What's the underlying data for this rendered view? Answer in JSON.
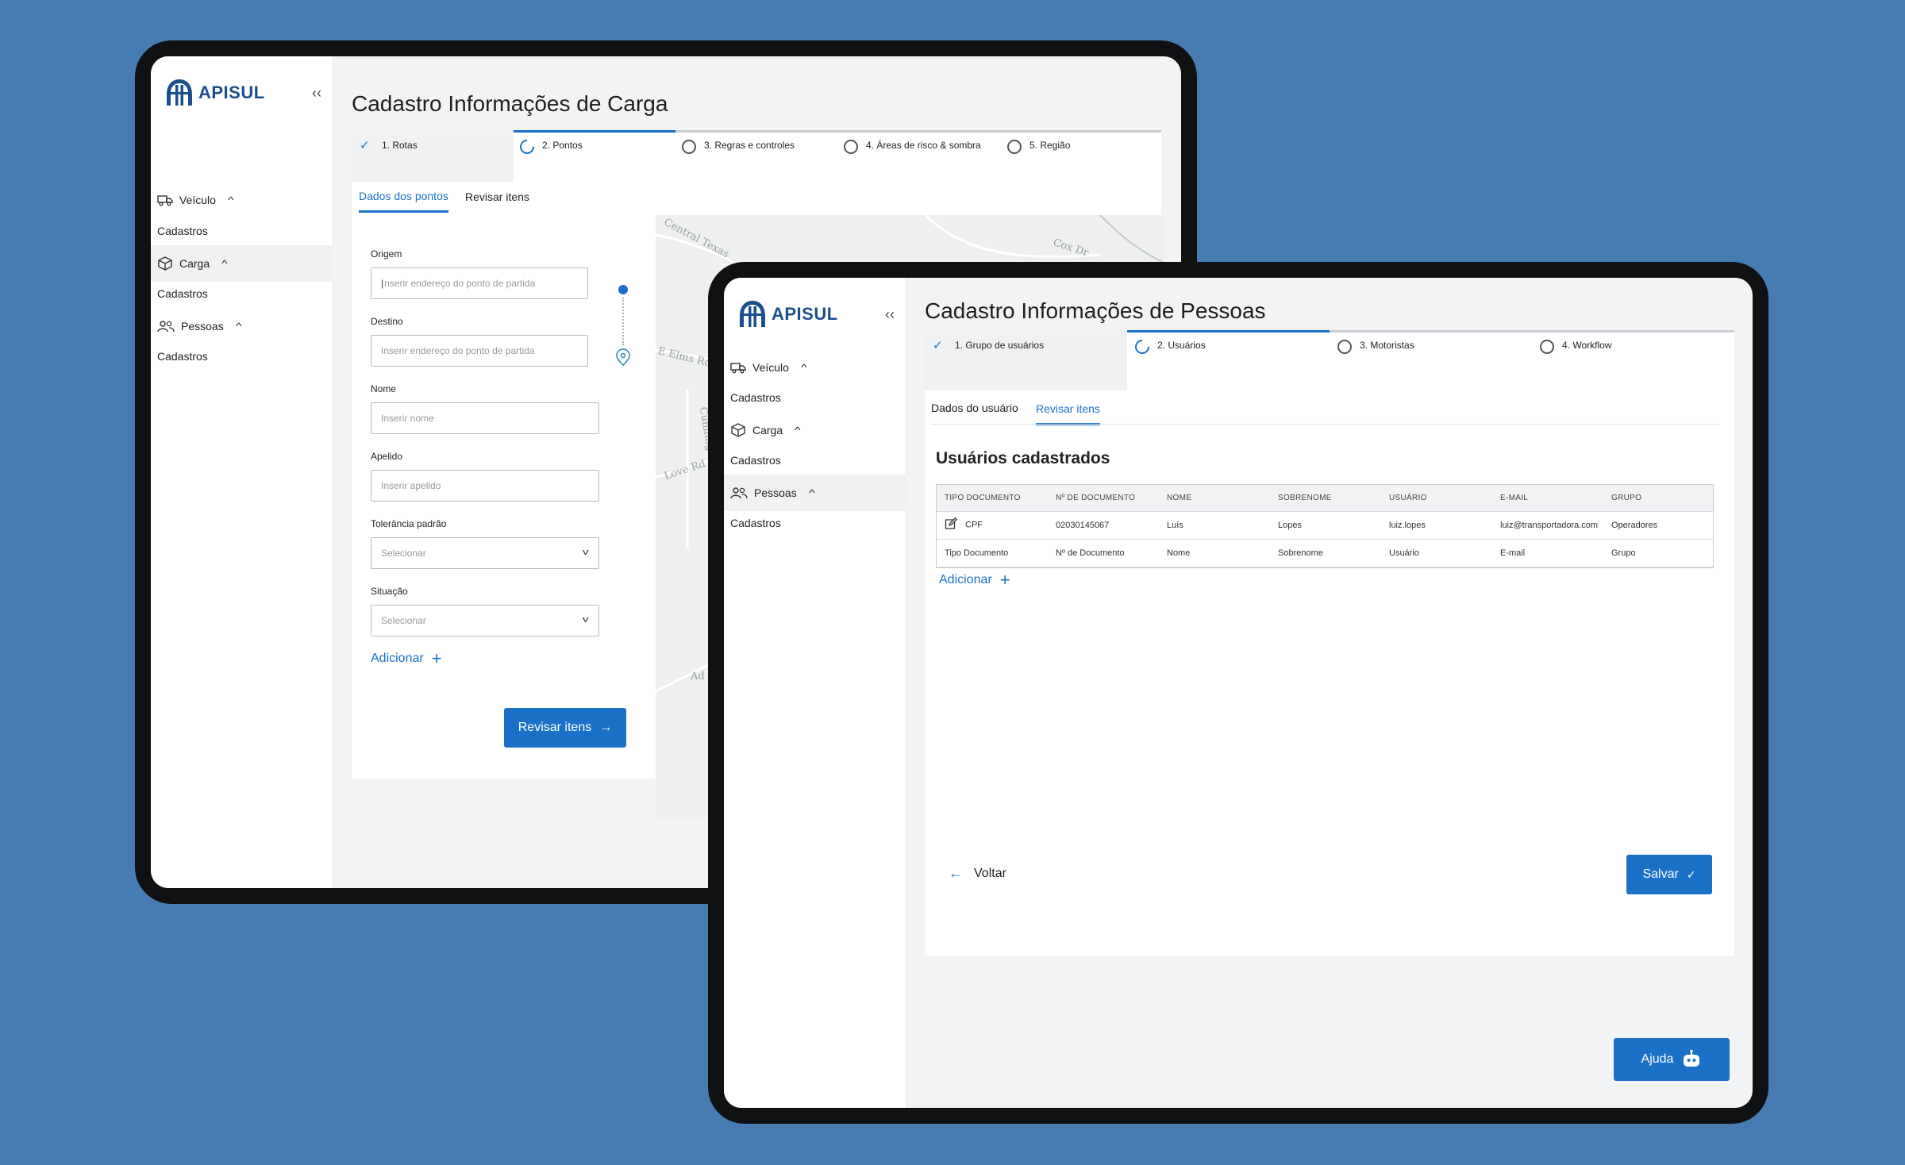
{
  "back_window": {
    "logo": "APISUL",
    "title": "Cadastro Informações de Carga",
    "sidebar": [
      {
        "label": "Veículo",
        "sub": "Cadastros"
      },
      {
        "label": "Carga",
        "sub": "Cadastros"
      },
      {
        "label": "Pessoas",
        "sub": "Cadastros"
      }
    ],
    "steps": [
      "1. Rotas",
      "2. Pontos",
      "3. Regras e controles",
      "4. Áreas de risco & sombra",
      "5. Região"
    ],
    "tabs": [
      "Dados dos pontos",
      "Revisar itens"
    ],
    "fields": {
      "origem_label": "Origem",
      "origem_placeholder": "nserir endereço do ponto de partida",
      "destino_label": "Destino",
      "destino_placeholder": "Inserir endereço do ponto de partida",
      "nome_label": "Nome",
      "nome_placeholder": "Inserir nome",
      "apelido_label": "Apelido",
      "apelido_placeholder": "Inserir apelido",
      "tolerancia_label": "Tolerância padrão",
      "tolerancia_value": "Selecionar",
      "situacao_label": "Situação",
      "situacao_value": "Selecionar"
    },
    "add_label": "Adicionar",
    "review_button": "Revisar itens",
    "map_labels": [
      "Central Texas",
      "Cox Dr",
      "E Elms Rd",
      "Cunning",
      "Love Rd",
      "Ad"
    ]
  },
  "front_window": {
    "logo": "APISUL",
    "title": "Cadastro Informações de Pessoas",
    "sidebar": [
      {
        "label": "Veículo",
        "sub": "Cadastros"
      },
      {
        "label": "Carga",
        "sub": "Cadastros"
      },
      {
        "label": "Pessoas",
        "sub": "Cadastros"
      }
    ],
    "steps": [
      "1. Grupo de usuários",
      "2. Usuários",
      "3. Motoristas",
      "4. Workflow"
    ],
    "tabs": [
      "Dados do usuário",
      "Revisar itens"
    ],
    "section_title": "Usuários cadastrados",
    "table": {
      "headers": [
        "TIPO DOCUMENTO",
        "Nº DE DOCUMENTO",
        "NOME",
        "SOBRENOME",
        "USUÁRIO",
        "E-MAIL",
        "GRUPO"
      ],
      "rows": [
        [
          "CPF",
          "02030145067",
          "Luís",
          "Lopes",
          "luiz.lopes",
          "luiz@transportadora.com",
          "Operadores"
        ],
        [
          "Tipo Documento",
          "Nº de Documento",
          "Nome",
          "Sobrenome",
          "Usuário",
          "E-mail",
          "Grupo"
        ]
      ]
    },
    "add_label": "Adicionar",
    "back_label": "Voltar",
    "save_label": "Salvar",
    "help_label": "Ajuda"
  },
  "colors": {
    "background": "#467cb2",
    "accent": "#1b71c7",
    "brand": "#1a4f8c"
  }
}
